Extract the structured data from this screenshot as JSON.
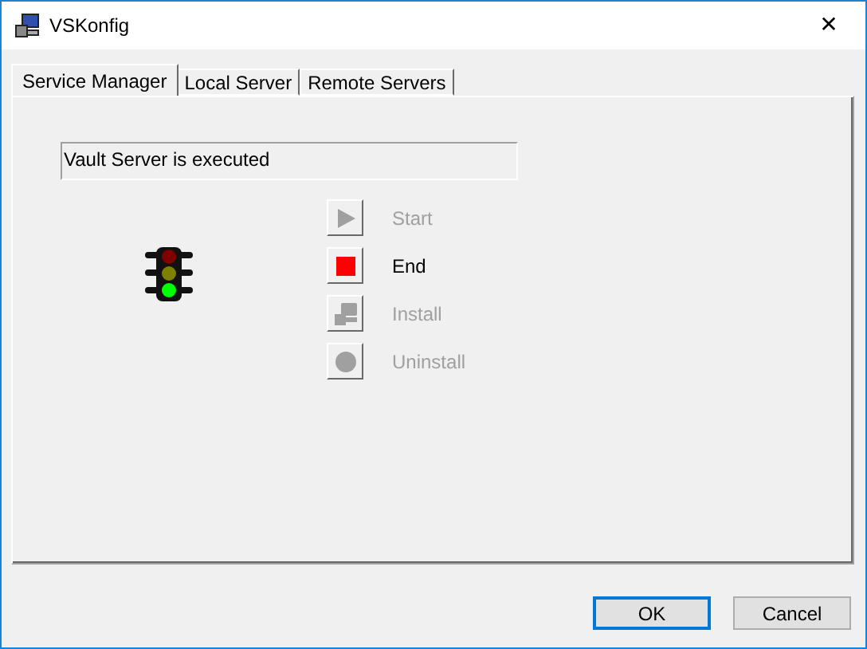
{
  "window": {
    "title": "VSKonfig",
    "close": "✕"
  },
  "tabs": [
    {
      "label": "Service Manager",
      "selected": true
    },
    {
      "label": "Local Server",
      "selected": false
    },
    {
      "label": "Remote Servers",
      "selected": false
    }
  ],
  "status": "Vault Server is executed",
  "lamps": [
    {
      "on": false
    },
    {
      "on": false
    },
    {
      "on": true
    }
  ],
  "actions": [
    {
      "kind": "start",
      "label": "Start",
      "disabled": true
    },
    {
      "kind": "end",
      "label": "End",
      "disabled": false
    },
    {
      "kind": "install",
      "label": "Install",
      "disabled": true
    },
    {
      "kind": "uninstall",
      "label": "Uninstall",
      "disabled": true
    }
  ],
  "buttons": [
    "OK",
    "Cancel"
  ]
}
